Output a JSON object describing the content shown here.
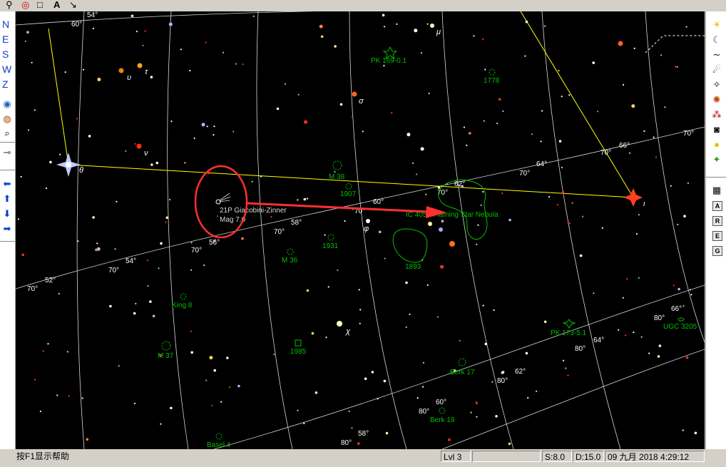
{
  "toolbar": {
    "icons": [
      "pointer-icon",
      "target-icon",
      "rectangle-icon",
      "text-a-icon",
      "line-icon"
    ],
    "text_icon_label": "A"
  },
  "left_toolbar": {
    "direction_labels": [
      "N",
      "E",
      "S",
      "W",
      "Z"
    ],
    "icons": [
      "globe-icon",
      "compass-icon",
      "zoom-icon",
      "key-icon",
      "arrow-left-icon",
      "arrow-up-icon",
      "arrow-down-icon",
      "arrow-right-icon"
    ]
  },
  "right_toolbar": {
    "icons": [
      "sun-icon",
      "moon-icon",
      "comet-icon",
      "asteroid-icon",
      "nebula-icon",
      "galaxy-icon",
      "cluster-icon",
      "camera-icon",
      "bulb-icon",
      "color-icon",
      "grid-icon"
    ],
    "letter_buttons": [
      "A",
      "R",
      "E",
      "G"
    ]
  },
  "chart": {
    "comet_label": "21P Giacobini-Zinner",
    "comet_mag": "Mag 7.0",
    "star_labels": {
      "mu": "μ",
      "sigma": "σ",
      "tau": "τ",
      "upsilon1": "υ",
      "upsilon2": "ν",
      "theta": "θ",
      "iota": "ι",
      "phi": "φ",
      "chi": "χ"
    },
    "objects": {
      "pk169": "PK 169-0.1",
      "n1778": "1778",
      "m38": "M 38",
      "n1907": "1907",
      "ic405": "IC 405 - Flaming Star Nebula",
      "n1931": "1931",
      "m36": "M 36",
      "n1893": "1893",
      "king8": "King 8",
      "pk173": "PK 173-5.1",
      "ugc3205": "UGC 3205",
      "m37": "M 37",
      "n1985": "1985",
      "berk17": "Berk 17",
      "berk19": "Berk 19",
      "basel4": "Basel 4"
    },
    "grid_labels": {
      "g54a": "54°",
      "g60a": "60°",
      "g70a": "70°",
      "g66a": "66°",
      "g64a": "64°",
      "g70b": "70°",
      "g60b": "60°",
      "g58a": "58°",
      "g56": "56°",
      "g70c": "70°",
      "g54b": "54°",
      "g70d": "70°",
      "g52": "52°",
      "g70e": "70°",
      "g62": "62°",
      "g64b": "64°",
      "g66b": "66°",
      "g80a": "80°",
      "g60c": "60°",
      "g80b": "80°",
      "g58b": "58°",
      "g80c": "80°",
      "g62b": "62°",
      "g80d": "80°",
      "g64c": "64°",
      "g80e": "80°",
      "g66c": "66°",
      "g70f": "70°",
      "g80f": "80°"
    },
    "colors": {
      "background": "#000000",
      "grid": "#ffffff",
      "constellation": "#ffff00",
      "dso": "#00c000",
      "annotation": "#ff3030"
    }
  },
  "status": {
    "help": "按F1显示帮助",
    "level": "Lvl 3",
    "scale": "S:8.0",
    "depth": "D:15.0",
    "datetime": "09 九月 2018 4:29:12"
  }
}
